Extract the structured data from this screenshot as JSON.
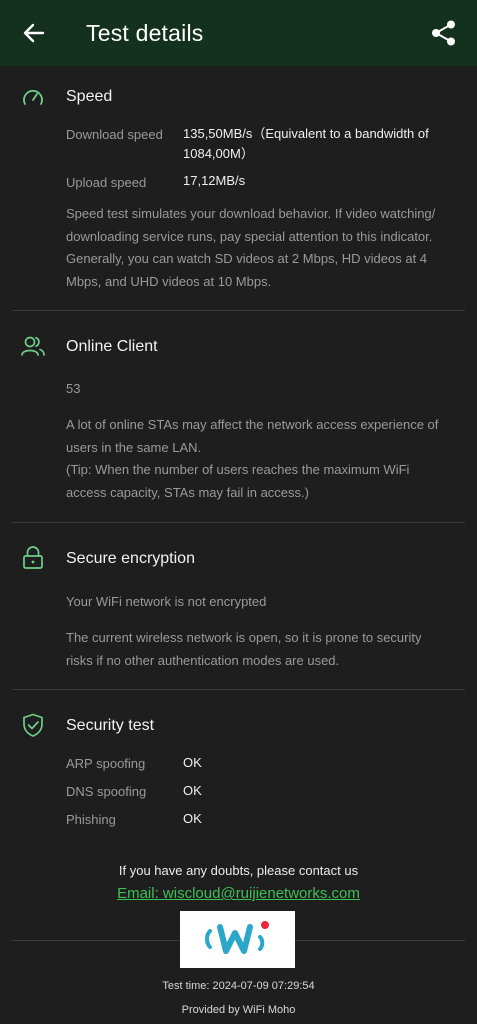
{
  "header": {
    "title": "Test details"
  },
  "speed": {
    "title": "Speed",
    "download_label": "Download speed",
    "download_value_line1": "135,50MB/s（Equivalent to a bandwidth of",
    "download_value_line2": "1084,00M）",
    "upload_label": "Upload speed",
    "upload_value": "17,12MB/s",
    "desc_lines": [
      "Speed test simulates your download behavior. If video watching/",
      "downloading service runs, pay special attention to this indicator.",
      "Generally, you can watch SD videos at 2 Mbps, HD videos at 4",
      "Mbps, and UHD videos at 10 Mbps."
    ]
  },
  "clients": {
    "title": "Online Client",
    "count": "53",
    "desc_lines": [
      "A lot of online STAs may affect the network access experience of",
      "users in the same LAN.",
      "(Tip: When the number of users reaches the maximum WiFi",
      "access capacity, STAs may fail in access.)"
    ]
  },
  "encryption": {
    "title": "Secure encryption",
    "status": "Your WiFi network is not encrypted",
    "desc_lines": [
      "The current wireless network is open, so it is prone to security",
      "risks if no other authentication modes are used."
    ]
  },
  "security": {
    "title": "Security test",
    "items": [
      {
        "label": "ARP spoofing",
        "value": "OK"
      },
      {
        "label": "DNS spoofing",
        "value": "OK"
      },
      {
        "label": "Phishing",
        "value": "OK"
      }
    ]
  },
  "contact": {
    "doubts": "If you have any doubts, please contact us",
    "email": "Email: wiscloud@ruijienetworks.com"
  },
  "footer": {
    "test_time": "Test time: 2024-07-09 07:29:54",
    "provided_by": "Provided by WiFi Moho"
  },
  "colors": {
    "appbar": "#14311f",
    "background": "#1e1e1e",
    "accent_green": "#3fbf57",
    "logo_blue": "#2aa7c9",
    "logo_red": "#e8253a"
  },
  "icons": [
    "back-arrow-icon",
    "share-icon",
    "speedometer-icon",
    "users-icon",
    "lock-icon",
    "shield-check-icon",
    "wifi-moho-logo"
  ]
}
